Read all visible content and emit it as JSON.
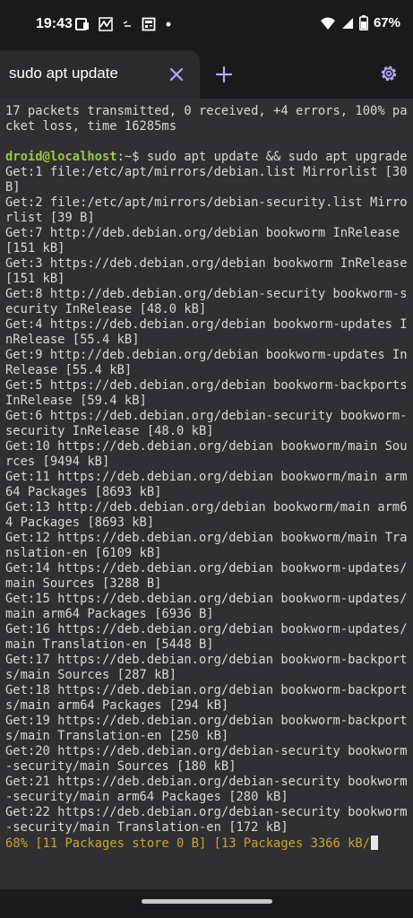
{
  "status_bar": {
    "time": "19:43",
    "battery": "67%",
    "icons_left": [
      "notification-icon",
      "activity-icon",
      "small-icon",
      "news-icon",
      "dot-icon"
    ],
    "icons_right": [
      "wifi-icon",
      "signal-icon",
      "battery-icon"
    ]
  },
  "tab_bar": {
    "tab_title": "sudo apt update",
    "accent_color": "#b6a8f5"
  },
  "terminal": {
    "header_lines": "17 packets transmitted, 0 received, +4 errors, 100% packet loss, time 16285ms\n",
    "prompt_user": "droid@localhost",
    "prompt_rest": ":~$ sudo apt update && sudo apt upgrade",
    "output": "Get:1 file:/etc/apt/mirrors/debian.list Mirrorlist [30 B]\nGet:2 file:/etc/apt/mirrors/debian-security.list Mirrorlist [39 B]\nGet:7 http://deb.debian.org/debian bookworm InRelease [151 kB]\nGet:3 https://deb.debian.org/debian bookworm InRelease [151 kB]\nGet:8 http://deb.debian.org/debian-security bookworm-security InRelease [48.0 kB]\nGet:4 https://deb.debian.org/debian bookworm-updates InRelease [55.4 kB]\nGet:9 http://deb.debian.org/debian bookworm-updates InRelease [55.4 kB]\nGet:5 https://deb.debian.org/debian bookworm-backports InRelease [59.4 kB]\nGet:6 https://deb.debian.org/debian-security bookworm-security InRelease [48.0 kB]\nGet:10 https://deb.debian.org/debian bookworm/main Sources [9494 kB]\nGet:11 https://deb.debian.org/debian bookworm/main arm64 Packages [8693 kB]\nGet:13 http://deb.debian.org/debian bookworm/main arm64 Packages [8693 kB]\nGet:12 https://deb.debian.org/debian bookworm/main Translation-en [6109 kB]\nGet:14 https://deb.debian.org/debian bookworm-updates/main Sources [3288 B]\nGet:15 https://deb.debian.org/debian bookworm-updates/main arm64 Packages [6936 B]\nGet:16 https://deb.debian.org/debian bookworm-updates/main Translation-en [5448 B]\nGet:17 https://deb.debian.org/debian bookworm-backports/main Sources [287 kB]\nGet:18 https://deb.debian.org/debian bookworm-backports/main arm64 Packages [294 kB]\nGet:19 https://deb.debian.org/debian bookworm-backports/main Translation-en [250 kB]\nGet:20 https://deb.debian.org/debian-security bookworm-security/main Sources [180 kB]\nGet:21 https://deb.debian.org/debian-security bookworm-security/main arm64 Packages [280 kB]\nGet:22 https://deb.debian.org/debian-security bookworm-security/main Translation-en [172 kB]\n",
    "progress": "68% [11 Packages store 0 B] [13 Packages 3366 kB/"
  }
}
